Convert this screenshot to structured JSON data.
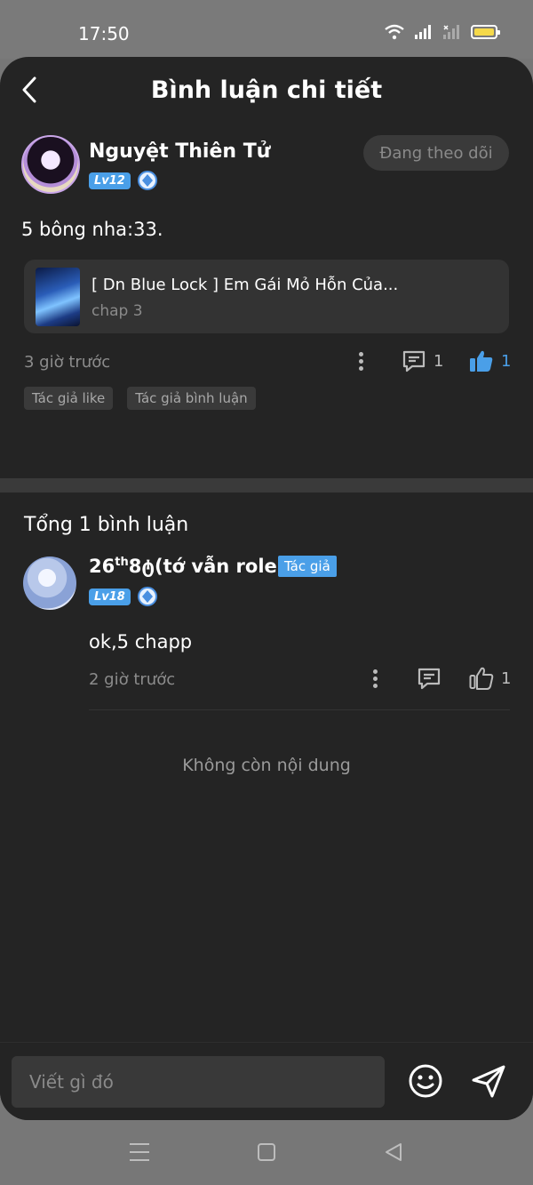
{
  "status": {
    "time": "17:50"
  },
  "header": {
    "title": "Bình luận chi tiết"
  },
  "post": {
    "author": "Nguyệt Thiên Tử",
    "level": "Lv12",
    "follow_label": "Đang theo dõi",
    "text": "5 bông nha:33.",
    "story": {
      "title": "[ Dn Blue Lock ] Em Gái Mỏ Hỗn Của...",
      "subtitle": "chap 3"
    },
    "time": "3 giờ trước",
    "comment_count": "1",
    "like_count": "1",
    "tags": [
      "Tác giả like",
      "Tác giả bình luận"
    ]
  },
  "comments": {
    "total": "Tổng 1 bình luận",
    "items": [
      {
        "name_prefix": "26",
        "name_sup": "th",
        "name_rest": "8ტ(tớ vẫn role)",
        "author_tag": "Tác giả",
        "level": "Lv18",
        "text": "ok,5 chapp",
        "time": "2 giờ trước",
        "like_count": "1"
      }
    ],
    "end_text": "Không còn nội dung"
  },
  "input": {
    "placeholder": "Viết gì đó"
  },
  "colors": {
    "accent": "#4a9fe8",
    "background": "#242424",
    "card": "#333333"
  }
}
